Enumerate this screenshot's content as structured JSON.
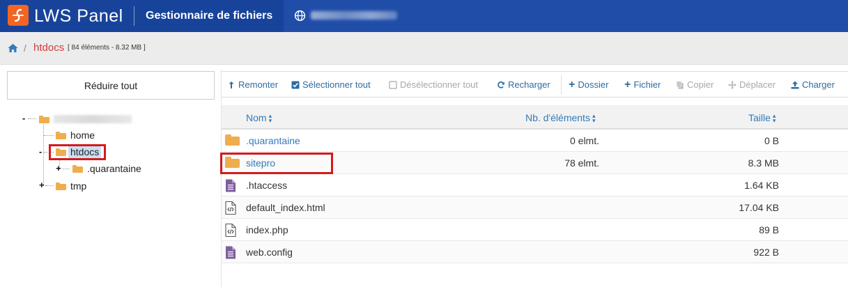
{
  "header": {
    "app_name": "LWS Panel",
    "section_title": "Gestionnaire de fichiers",
    "colors": {
      "bar": "#1f4da8",
      "logo_bg": "#17439a",
      "logo_mark": "#f26522"
    }
  },
  "breadcrumb": {
    "home_icon": "home-icon",
    "separator": "/",
    "current": "htdocs",
    "info": "[ 84 éléments - 8.32 MB ]"
  },
  "tree": {
    "collapse_all": "Réduire tout",
    "nodes": [
      {
        "label": "home"
      },
      {
        "label": "htdocs"
      },
      {
        "label": ".quarantaine"
      },
      {
        "label": "tmp"
      }
    ]
  },
  "toolbar": {
    "up": "Remonter",
    "select_all": "Sélectionner tout",
    "deselect_all": "Désélectionner tout",
    "reload": "Recharger",
    "new_folder": "Dossier",
    "new_file": "Fichier",
    "copy": "Copier",
    "move": "Déplacer",
    "upload": "Charger"
  },
  "table": {
    "columns": {
      "name": "Nom",
      "count": "Nb. d'éléments",
      "size": "Taille"
    },
    "rows": [
      {
        "name": ".quarantaine",
        "count": "0 elmt.",
        "size": "0 B",
        "type": "folder"
      },
      {
        "name": "sitepro",
        "count": "78 elmt.",
        "size": "8.3 MB",
        "type": "folder"
      },
      {
        "name": ".htaccess",
        "count": "",
        "size": "1.64 KB",
        "type": "file"
      },
      {
        "name": "default_index.html",
        "count": "",
        "size": "17.04 KB",
        "type": "code"
      },
      {
        "name": "index.php",
        "count": "",
        "size": "89 B",
        "type": "code"
      },
      {
        "name": "web.config",
        "count": "",
        "size": "922 B",
        "type": "file"
      }
    ]
  }
}
